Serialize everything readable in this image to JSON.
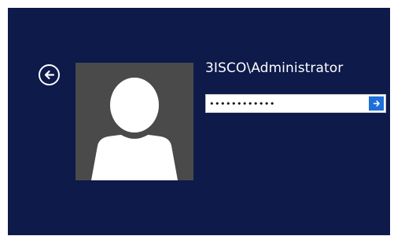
{
  "login": {
    "username": "3ISCO\\Administrator",
    "password_value": "••••••••••••",
    "back_icon": "arrow-left-circle-icon",
    "submit_icon": "arrow-right-icon",
    "avatar_icon": "user-silhouette-icon"
  },
  "colors": {
    "background": "#0d1a4a",
    "avatar_bg": "#4a4a4a",
    "submit_bg": "#1e6fd9"
  }
}
